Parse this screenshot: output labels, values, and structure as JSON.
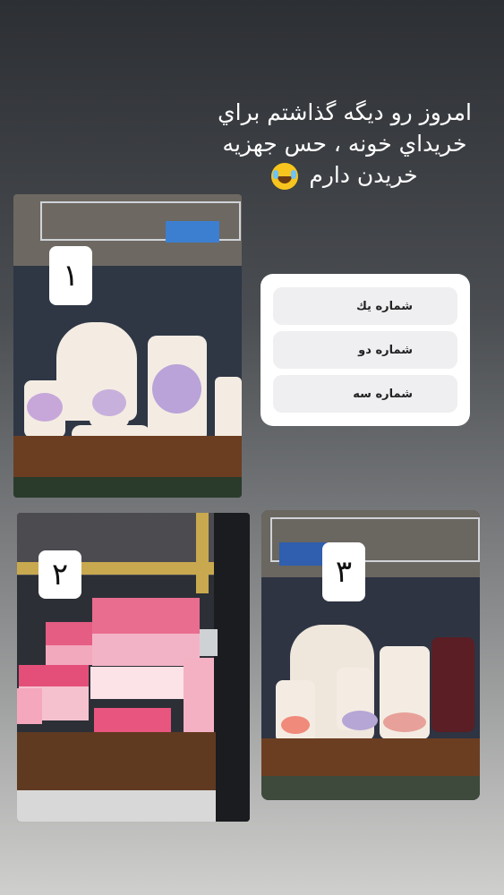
{
  "caption": {
    "text": "امروز رو ديگه گذاشتم براي خريداي خونه ، حس جهزيه خريدن دارم",
    "emoji": "face-with-tears-of-joy"
  },
  "photos": [
    {
      "label": "١"
    },
    {
      "label": "٢"
    },
    {
      "label": "٣"
    }
  ],
  "poll": {
    "options": [
      "شماره يك",
      "شماره دو",
      "شماره سه"
    ]
  }
}
